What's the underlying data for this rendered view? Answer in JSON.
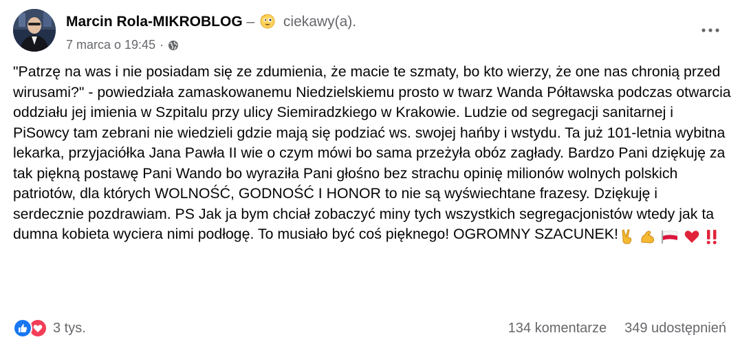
{
  "post": {
    "author": "Marcin Rola-MIKROBLOG",
    "dash": "–",
    "feeling": "ciekawy(a).",
    "feeling_icon": "curious-face-emoji",
    "timestamp": "7 marca o 19:45",
    "meta_separator": "·",
    "privacy_icon": "globe-icon",
    "text": "\"Patrzę na was i nie posiadam się ze zdumienia, że macie te szmaty, bo kto wierzy, że one nas chronią przed wirusami?\" - powiedziała zamaskowanemu Niedzielskiemu prosto w twarz Wanda Półtawska podczas otwarcia oddziału jej imienia w Szpitalu przy ulicy Siemiradzkiego w Krakowie. Ludzie od segregacji sanitarnej i PiSowcy tam zebrani nie wiedzieli gdzie mają się podziać ws. swojej hańby i wstydu. Ta już 101-letnia wybitna lekarka, przyjaciółka Jana Pawła II wie o czym mówi bo sama przeżyła obóz zagłady. Bardzo Pani dziękuję za tak piękną postawę Pani Wando bo wyraziła Pani głośno bez strachu opinię milionów wolnych polskich patriotów, dla których WOLNOŚĆ, GODNOŚĆ I HONOR to nie są wyświechtane frazesy. Dziękuję i serdecznie pozdrawiam. PS Jak ja bym chciał zobaczyć miny tych wszystkich segregacjonistów wtedy jak ta dumna kobieta wyciera nimi podłogę. To musiało być coś pięknego! OGROMNY SZACUNEK!",
    "trailing_emojis": [
      "victory-hand-emoji",
      "flexed-biceps-emoji",
      "poland-flag-emoji",
      "red-heart-emoji",
      "double-exclamation-emoji"
    ]
  },
  "footer": {
    "reaction_icons": [
      "like-icon",
      "love-icon"
    ],
    "reaction_count": "3 tys.",
    "comments": "134 komentarze",
    "shares": "349 udostępnień"
  },
  "colors": {
    "text": "#050505",
    "secondary": "#65676b",
    "like_blue": "#1877f2",
    "love_red": "#f33e58"
  }
}
